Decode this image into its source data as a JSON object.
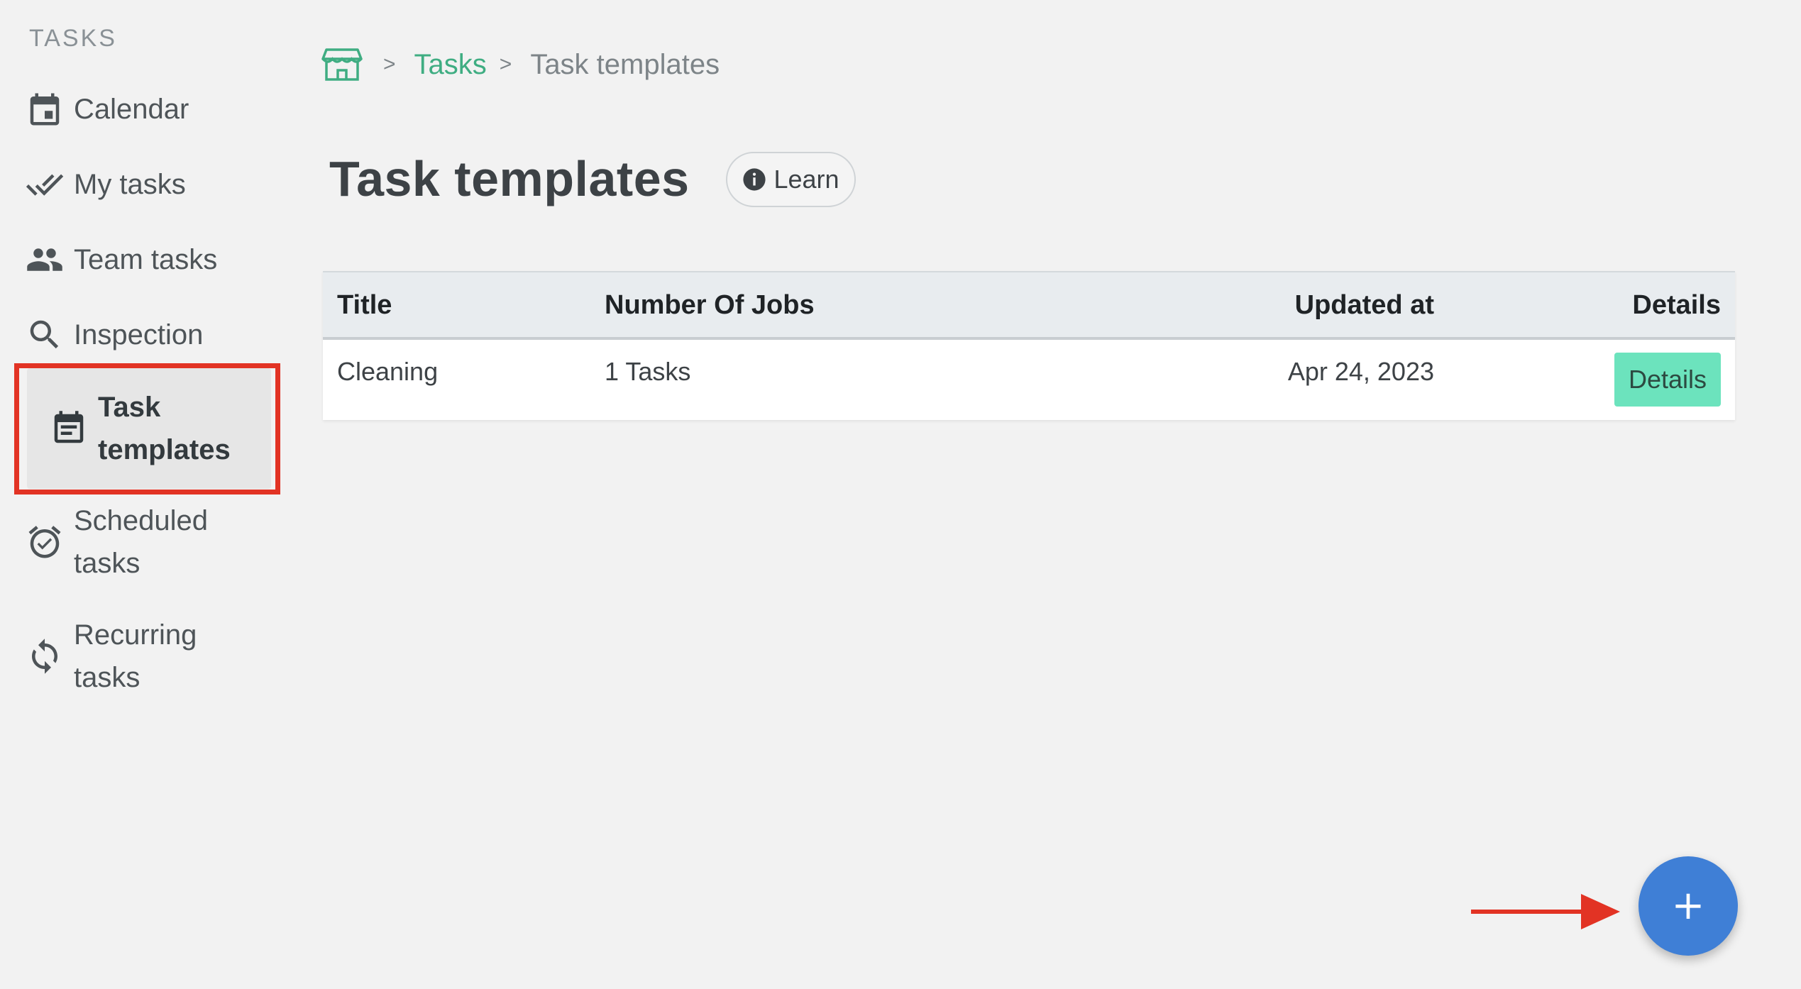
{
  "sidebar": {
    "heading": "TASKS",
    "items": [
      {
        "label": "Calendar",
        "icon": "calendar-icon"
      },
      {
        "label": "My tasks",
        "icon": "double-check-icon"
      },
      {
        "label": "Team tasks",
        "icon": "people-icon"
      },
      {
        "label": "Inspection",
        "icon": "search-icon"
      },
      {
        "label": "Task templates",
        "icon": "event-note-icon",
        "active": true
      },
      {
        "label": "Scheduled tasks",
        "icon": "alarm-check-icon"
      },
      {
        "label": "Recurring tasks",
        "icon": "sync-icon"
      }
    ],
    "highlight_color": "#e23324"
  },
  "breadcrumb": {
    "home_icon": "home-store-icon",
    "link": "Tasks",
    "current": "Task templates",
    "link_color": "#3fad82"
  },
  "page": {
    "title": "Task templates",
    "learn_label": "Learn"
  },
  "table": {
    "columns": [
      "Title",
      "Number Of Jobs",
      "Updated at",
      "Details"
    ],
    "rows": [
      {
        "title": "Cleaning",
        "jobs": "1 Tasks",
        "updated": "Apr 24, 2023",
        "details_label": "Details"
      }
    ],
    "details_button_color": "#6ce3bd"
  },
  "fab": {
    "label": "+",
    "color": "#3f7fd6"
  },
  "annotation": {
    "arrow_color": "#e23324"
  }
}
